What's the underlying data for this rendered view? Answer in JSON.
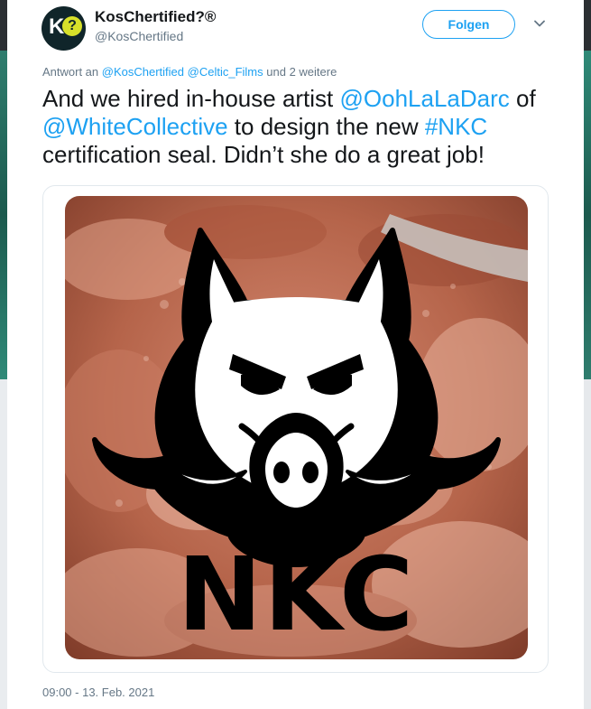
{
  "account": {
    "display_name": "KosChertified?®",
    "handle": "@KosChertified",
    "avatar_letter": "K",
    "avatar_symbol": "?"
  },
  "follow_button": {
    "label": "Folgen"
  },
  "reply_context": {
    "prefix": "Antwort an",
    "mention_1": "@KosChertified",
    "mention_2": "@Celtic_Films",
    "suffix": "und 2 weitere"
  },
  "tweet": {
    "part1": "And we hired in-house artist ",
    "mention_artist": "@OohLaLaDarc",
    "part2": " of ",
    "mention_collective": "@WhiteCollective",
    "part3": " to design the new ",
    "hashtag": "#NKC",
    "part4": " certification seal. Didn’t she do a great job!"
  },
  "media": {
    "seal_text": "NKC",
    "icon": "boar-head-seal"
  },
  "timestamp": "09:00 - 13. Feb. 2021",
  "colors": {
    "link": "#1da1f2",
    "text": "#14171a",
    "secondary": "#657786",
    "avatar_bg": "#10252a",
    "avatar_accent": "#d8e12a"
  }
}
